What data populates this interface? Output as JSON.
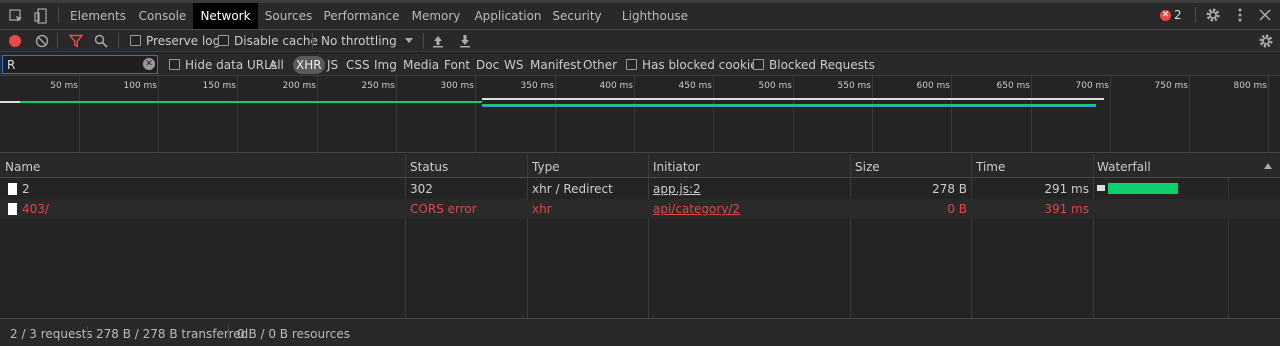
{
  "tabs": [
    "Elements",
    "Console",
    "Network",
    "Sources",
    "Performance",
    "Memory",
    "Application",
    "Security",
    "Lighthouse"
  ],
  "active_tab": "Network",
  "error_count": "2",
  "toolbar": {
    "preserve_log": "Preserve log",
    "disable_cache": "Disable cache",
    "throttling": "No throttling"
  },
  "filter": {
    "value": "R",
    "hide_data_urls": "Hide data URLs",
    "types": [
      "All",
      "XHR",
      "JS",
      "CSS",
      "Img",
      "Media",
      "Font",
      "Doc",
      "WS",
      "Manifest",
      "Other"
    ],
    "active_type": "XHR",
    "has_blocked_cookies": "Has blocked cookies",
    "blocked_requests": "Blocked Requests"
  },
  "overview": {
    "ticks": [
      "50 ms",
      "100 ms",
      "150 ms",
      "200 ms",
      "250 ms",
      "300 ms",
      "350 ms",
      "400 ms",
      "450 ms",
      "500 ms",
      "550 ms",
      "600 ms",
      "650 ms",
      "700 ms",
      "750 ms",
      "800 ms"
    ]
  },
  "table": {
    "columns": [
      "Name",
      "Status",
      "Type",
      "Initiator",
      "Size",
      "Time",
      "Waterfall"
    ],
    "rows": [
      {
        "name": "2",
        "status": "302",
        "type": "xhr / Redirect",
        "initiator": "app.js:2",
        "size": "278 B",
        "time": "291 ms",
        "error": false
      },
      {
        "name": "403/",
        "status": "CORS error",
        "type": "xhr",
        "initiator": "api/category/2",
        "size": "0 B",
        "time": "391 ms",
        "error": true
      }
    ]
  },
  "status": {
    "requests": "2 / 3 requests",
    "transferred": "278 B / 278 B transferred",
    "resources": "0 B / 0 B resources"
  },
  "colors": {
    "accent": "#1a73e8",
    "error": "#e24646",
    "waterfall_green": "#0cce6b",
    "record": "#e94b4b"
  }
}
